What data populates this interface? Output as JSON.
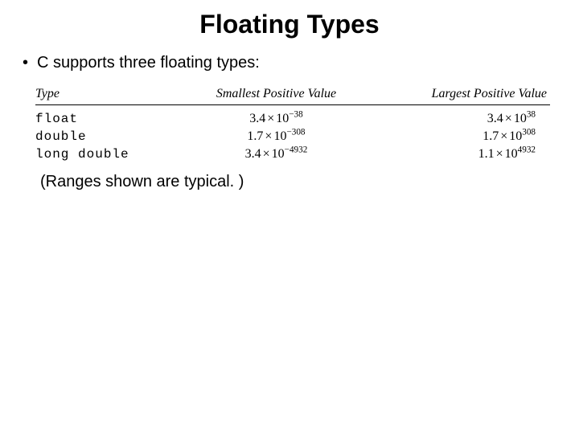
{
  "title": "Floating Types",
  "bullet1": "C supports three floating types:",
  "note": "(Ranges shown are typical. )",
  "headers": {
    "type": "Type",
    "smallest": "Smallest Positive Value",
    "largest": "Largest Positive Value"
  },
  "rows": [
    {
      "type": "float",
      "smallest": {
        "mantissa": "3.4",
        "exp": "−38"
      },
      "largest": {
        "mantissa": "3.4",
        "exp": "38"
      }
    },
    {
      "type": "double",
      "smallest": {
        "mantissa": "1.7",
        "exp": "−308"
      },
      "largest": {
        "mantissa": "1.7",
        "exp": "308"
      }
    },
    {
      "type": "long double",
      "smallest": {
        "mantissa": "3.4",
        "exp": "−4932"
      },
      "largest": {
        "mantissa": "1.1",
        "exp": "4932"
      }
    }
  ],
  "chart_data": {
    "type": "table",
    "title": "Floating Types",
    "columns": [
      "Type",
      "Smallest Positive Value",
      "Largest Positive Value"
    ],
    "rows": [
      {
        "Type": "float",
        "Smallest Positive Value": "3.4 × 10^-38",
        "Largest Positive Value": "3.4 × 10^38"
      },
      {
        "Type": "double",
        "Smallest Positive Value": "1.7 × 10^-308",
        "Largest Positive Value": "1.7 × 10^308"
      },
      {
        "Type": "long double",
        "Smallest Positive Value": "3.4 × 10^-4932",
        "Largest Positive Value": "1.1 × 10^4932"
      }
    ]
  }
}
